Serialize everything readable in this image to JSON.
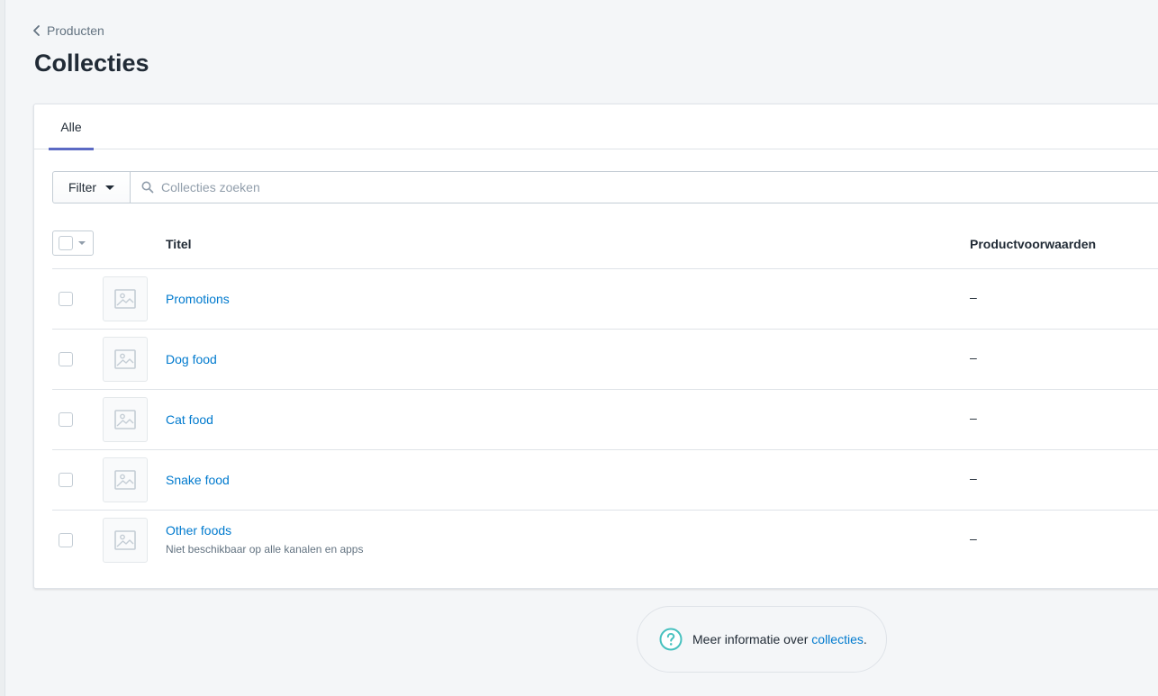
{
  "breadcrumb": {
    "label": "Producten"
  },
  "page": {
    "title": "Collecties"
  },
  "tabs": [
    {
      "label": "Alle",
      "active": true
    }
  ],
  "filter": {
    "label": "Filter"
  },
  "search": {
    "placeholder": "Collecties zoeken",
    "value": ""
  },
  "table": {
    "columns": {
      "title": "Titel",
      "conditions": "Productvoorwaarden"
    },
    "rows": [
      {
        "title": "Promotions",
        "subtitle": "",
        "conditions": "–"
      },
      {
        "title": "Dog food",
        "subtitle": "",
        "conditions": "–"
      },
      {
        "title": "Cat food",
        "subtitle": "",
        "conditions": "–"
      },
      {
        "title": "Snake food",
        "subtitle": "",
        "conditions": "–"
      },
      {
        "title": "Other foods",
        "subtitle": "Niet beschikbaar op alle kanalen en apps",
        "conditions": "–"
      }
    ]
  },
  "help": {
    "text": "Meer informatie over ",
    "link": "collecties",
    "suffix": "."
  },
  "colors": {
    "accent": "#5c6ac4",
    "link": "#007ace",
    "help_icon": "#47c1bf"
  },
  "icons": {
    "back": "chevron-left-icon",
    "search": "search-icon",
    "image_placeholder": "image-placeholder-icon",
    "help": "question-circle-icon"
  }
}
